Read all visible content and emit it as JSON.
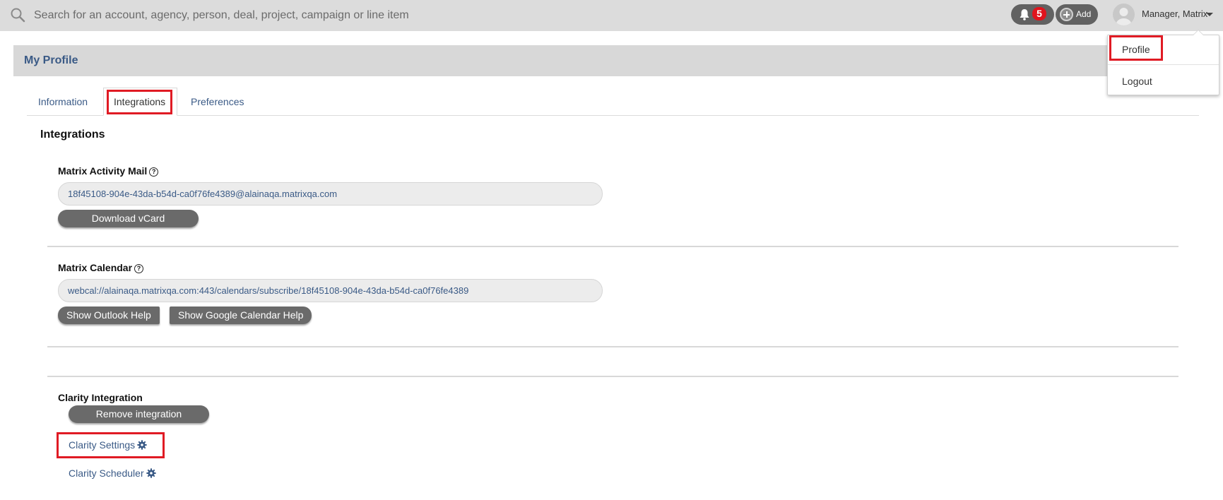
{
  "search": {
    "placeholder": "Search for an account, agency, person, deal, project, campaign or line item"
  },
  "header": {
    "notification_count": "5",
    "add_label": "Add",
    "user_name": "Manager, Matrix"
  },
  "user_menu": {
    "items": [
      {
        "label": "Profile"
      },
      {
        "label": "Logout"
      }
    ]
  },
  "page": {
    "title": "My Profile"
  },
  "tabs": [
    {
      "label": "Information"
    },
    {
      "label": "Integrations"
    },
    {
      "label": "Preferences"
    }
  ],
  "integrations": {
    "section_title": "Integrations",
    "activity_mail": {
      "label": "Matrix Activity Mail",
      "value": "18f45108-904e-43da-b54d-ca0f76fe4389@alainaqa.matrixqa.com",
      "button": "Download vCard"
    },
    "calendar": {
      "label": "Matrix Calendar",
      "value": "webcal://alainaqa.matrixqa.com:443/calendars/subscribe/18f45108-904e-43da-b54d-ca0f76fe4389",
      "outlook_button": "Show Outlook Help",
      "google_button": "Show Google Calendar Help"
    },
    "clarity": {
      "label": "Clarity Integration",
      "remove_button": "Remove integration",
      "settings_link": "Clarity Settings",
      "scheduler_link": "Clarity Scheduler"
    }
  },
  "colors": {
    "accent_link": "#3a5a86",
    "highlight": "#e01b24",
    "badge": "#e0141d",
    "button": "#6a6a6a"
  },
  "icons": [
    "search-icon",
    "bell-icon",
    "plus-icon",
    "avatar",
    "chevron-down-icon",
    "help-icon",
    "gear-icon"
  ]
}
